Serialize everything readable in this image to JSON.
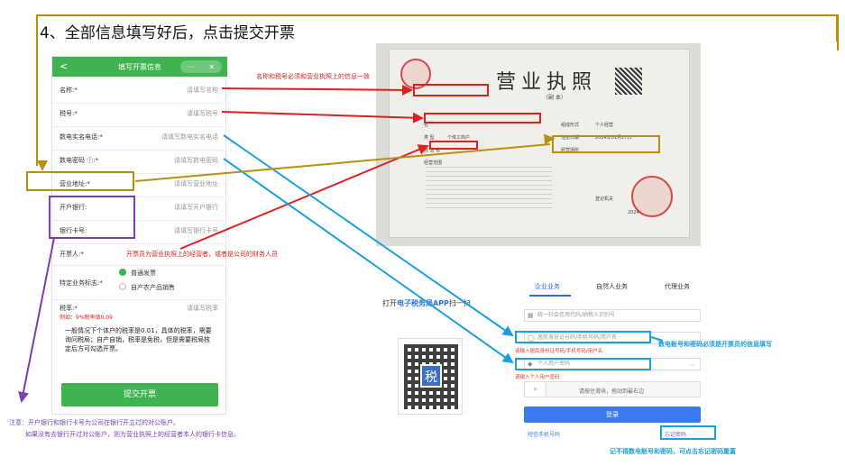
{
  "title": "4、全部信息填写好后，点击提交开票",
  "phone": {
    "header_back": "<",
    "header_title": "填写开票信息",
    "header_more": "···",
    "header_close": "✕",
    "fields": [
      {
        "label": "名称:*",
        "placeholder": "请填写名称"
      },
      {
        "label": "税号:*",
        "placeholder": "请填写税号"
      },
      {
        "label": "数电实名电话:*",
        "placeholder": "请填写数电实名电话"
      },
      {
        "label": "数电密码 ⓘ:*",
        "placeholder": "请填写数电密码"
      },
      {
        "label": "营业地址:*",
        "placeholder": "请填写营业地址"
      },
      {
        "label": "开户银行:",
        "placeholder": "请填写开户银行"
      },
      {
        "label": "银行卡号:",
        "placeholder": "请填写银行卡号"
      }
    ],
    "issuer_label": "开票人:*",
    "business_label": "特定业务标志:*",
    "option_normal": "普通发票",
    "option_farm": "自产农产品销售",
    "taxrate_label": "税率:*",
    "taxrate_placeholder": "请填写税率",
    "taxrate_example": "例如：9%税率填0.09",
    "note_text": "一般情况下个体户的税率是0.01，具体的税率，需要询问税局；自产自销，税率是免税，但是需要税局核定后方可勾选开票。",
    "submit_label": "提交开票"
  },
  "license": {
    "title": "营业执照",
    "subtitle": "（副 本）",
    "labels": [
      "名",
      "类 型",
      "经 营 者",
      "经营范围",
      "组成形式",
      "注册日期",
      "经营场所"
    ],
    "type_value": "个体工商户",
    "form_value": "个人经营",
    "register_date": "2024年01月27日",
    "authority": "登记机关",
    "year": "2024"
  },
  "annotations": {
    "name_tax_note": "名称和税号必须和营业执照上的信息一致",
    "issuer_note": "开票员为营业执照上的经营者，或者是公司的财务人员",
    "scan_prefix": "打开",
    "scan_app": "电子税务局APP",
    "scan_suffix": "扫一扫",
    "login_note": "数电账号和密码必须是开票员的信息填写",
    "forgot_note": "记不得数电账号和密码，可点击忘记密码重置",
    "bank_note_1": "注意：开户银行和银行卡号为公司在银行开立过的对公账户。",
    "bank_note_2": "如果没有去银行开过对公账户，则为营业执照上的经营者本人的银行卡信息。"
  },
  "login": {
    "tab_enterprise": "企业业务",
    "tab_personal": "自然人业务",
    "tab_agent": "代理业务",
    "field_credit": "统一社会信用代码/纳税人识别号",
    "field_account": "居民身份证号码/手机号码/用户名",
    "err_account": "请输入居民身份证号码/手机号码/用户名",
    "field_password": "个人用户密码",
    "err_password": "请输入个人用户密码",
    "slider_text": "请按住滑块，拖动到最右边",
    "login_button": "登录",
    "phone_login": "短信手机号码",
    "forgot_password": "忘记密码"
  },
  "qr": {
    "mark": "税"
  },
  "colors": {
    "green": "#3fb350",
    "red": "#e02020",
    "blue": "#1aa0e0",
    "purple": "#7a3fb0",
    "gold": "#b8900f"
  }
}
